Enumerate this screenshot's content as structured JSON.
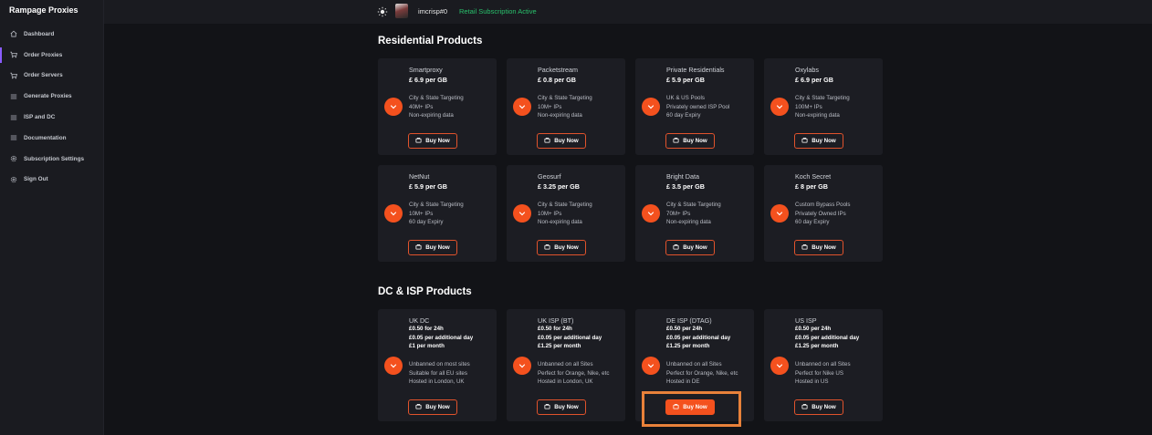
{
  "app": {
    "title": "Rampage Proxies"
  },
  "sidebar": {
    "items": [
      {
        "label": "Dashboard",
        "icon": "home-icon"
      },
      {
        "label": "Order Proxies",
        "icon": "cart-icon"
      },
      {
        "label": "Order Servers",
        "icon": "cart-icon"
      },
      {
        "label": "Generate Proxies",
        "icon": "list-icon"
      },
      {
        "label": "ISP and DC",
        "icon": "list-icon"
      },
      {
        "label": "Documentation",
        "icon": "list-icon"
      },
      {
        "label": "Subscription Settings",
        "icon": "gear-icon"
      },
      {
        "label": "Sign Out",
        "icon": "gear-icon"
      }
    ],
    "active_index": 1
  },
  "topbar": {
    "theme_icon": "sun-icon",
    "username": "imcrisp#0",
    "subscription_status": "Retail Subscription Active",
    "status_color": "#29c26c"
  },
  "accent_color": "#f4511e",
  "sections": {
    "residential": {
      "title": "Residential Products",
      "products": [
        {
          "name": "Smartproxy",
          "price": "£ 6.9 per GB",
          "features": [
            "City & State Targeting",
            "40M+ IPs",
            "Non-expiring data"
          ],
          "button": "Buy Now"
        },
        {
          "name": "Packetstream",
          "price": "£ 0.8 per GB",
          "features": [
            "City & State Targeting",
            "10M+ IPs",
            "Non-expiring data"
          ],
          "button": "Buy Now"
        },
        {
          "name": "Private Residentials",
          "price": "£ 5.9 per GB",
          "features": [
            "UK & US Pools",
            "Privately owned ISP Pool",
            "60 day Expiry"
          ],
          "button": "Buy Now"
        },
        {
          "name": "Oxylabs",
          "price": "£ 6.9 per GB",
          "features": [
            "City & State Targeting",
            "100M+ IPs",
            "Non-expiring data"
          ],
          "button": "Buy Now"
        },
        {
          "name": "NetNut",
          "price": "£ 5.9 per GB",
          "features": [
            "City & State Targeting",
            "10M+ IPs",
            "60 day Expiry"
          ],
          "button": "Buy Now"
        },
        {
          "name": "Geosurf",
          "price": "£ 3.25 per GB",
          "features": [
            "City & State Targeting",
            "10M+ IPs",
            "Non-expiring data"
          ],
          "button": "Buy Now"
        },
        {
          "name": "Bright Data",
          "price": "£ 3.5 per GB",
          "features": [
            "City & State Targeting",
            "70M+ IPs",
            "Non-expiring data"
          ],
          "button": "Buy Now"
        },
        {
          "name": "Koch Secret",
          "price": "£ 8 per GB",
          "features": [
            "Custom Bypass Pools",
            "Privately Owned IPs",
            "60 day Expiry"
          ],
          "button": "Buy Now"
        }
      ]
    },
    "dc_isp": {
      "title": "DC & ISP Products",
      "products": [
        {
          "name": "UK DC",
          "prices": [
            "£0.50 for 24h",
            "£0.05 per additional day",
            "£1 per month"
          ],
          "features": [
            "Unbanned on most sites",
            "Suitable for all EU sites",
            "Hosted in London, UK"
          ],
          "button": "Buy Now"
        },
        {
          "name": "UK ISP (BT)",
          "prices": [
            "£0.50 for 24h",
            "£0.05 per additional day",
            "£1.25 per month"
          ],
          "features": [
            "Unbanned on all Sites",
            "Perfect for Orange, Nike, etc",
            "Hosted in London, UK"
          ],
          "button": "Buy Now"
        },
        {
          "name": "DE ISP (DTAG)",
          "prices": [
            "£0.50 per 24h",
            "£0.05 per additional day",
            "£1.25 per month"
          ],
          "features": [
            "Unbanned on all Sites",
            "Perfect for Orange, Nike, etc",
            "Hosted in DE"
          ],
          "button": "Buy Now"
        },
        {
          "name": "US ISP",
          "prices": [
            "£0.50 per 24h",
            "£0.05 per additional day",
            "£1.25 per month"
          ],
          "features": [
            "Unbanned on all Sites",
            "Perfect for Nike US",
            "Hosted in US"
          ],
          "button": "Buy Now"
        }
      ]
    }
  }
}
